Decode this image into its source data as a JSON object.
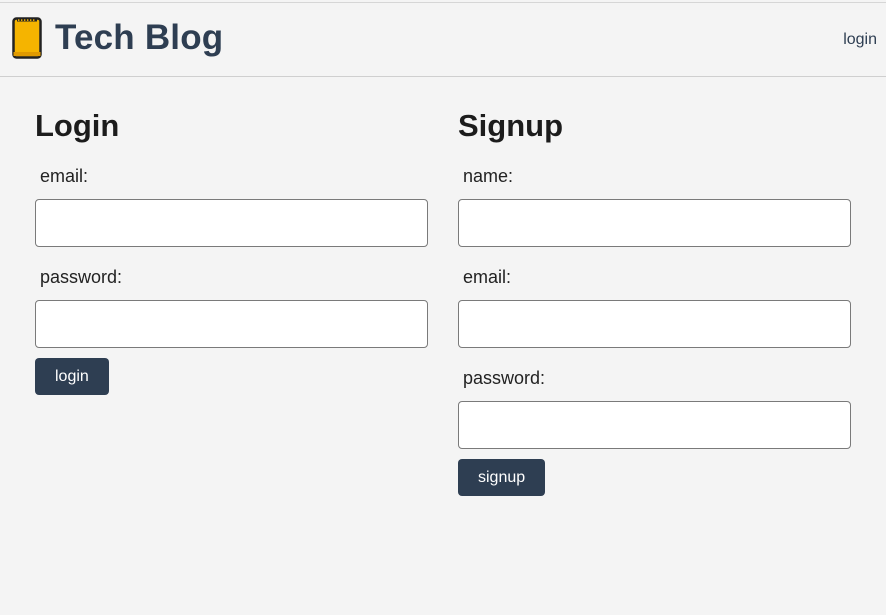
{
  "header": {
    "title": "Tech Blog",
    "icon": "notebook-icon",
    "nav_login": "login"
  },
  "login": {
    "heading": "Login",
    "email_label": "email:",
    "email_value": "",
    "password_label": "password:",
    "password_value": "",
    "button": "login"
  },
  "signup": {
    "heading": "Signup",
    "name_label": "name:",
    "name_value": "",
    "email_label": "email:",
    "email_value": "",
    "password_label": "password:",
    "password_value": "",
    "button": "signup"
  },
  "colors": {
    "background": "#f4f4f4",
    "accent": "#2e3e52",
    "icon_fill": "#f5b400"
  }
}
